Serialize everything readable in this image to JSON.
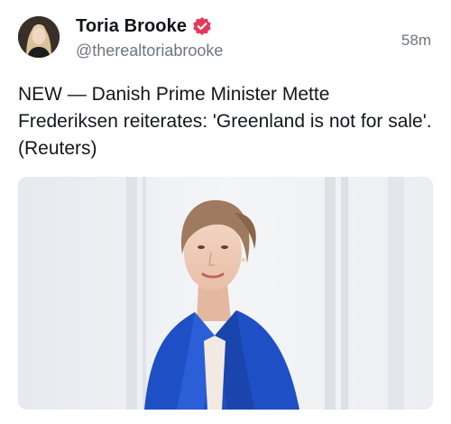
{
  "author": {
    "display_name": "Toria Brooke",
    "handle": "@therealtoriabrooke",
    "verified": true,
    "avatar_icon": "profile-photo"
  },
  "post": {
    "timestamp": "58m",
    "text": "NEW — Danish Prime Minister Mette Frederiksen reiterates: 'Greenland is not for sale'. (Reuters)",
    "media_icon": "photo-woman-blue-blazer"
  },
  "colors": {
    "verified_badge": "#e8375a",
    "muted_text": "#6e767d",
    "blazer": "#1f4fc4"
  }
}
